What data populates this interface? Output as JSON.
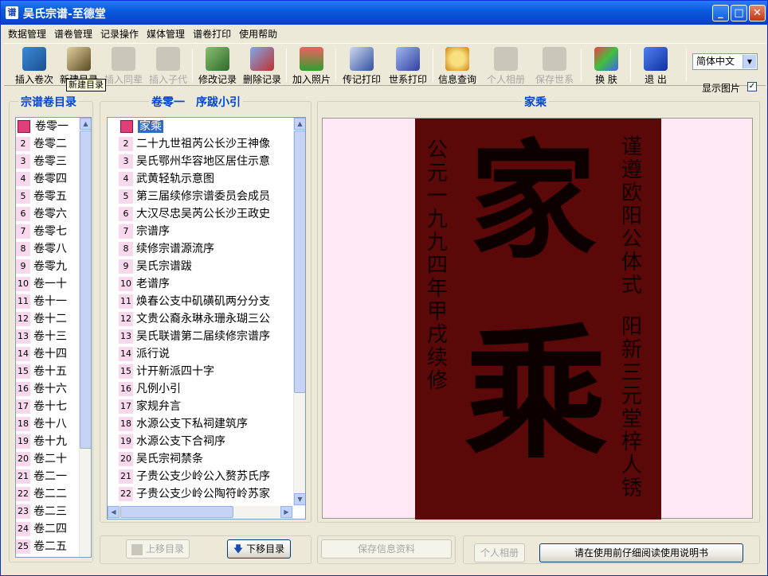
{
  "window": {
    "icon": "谱",
    "title": "吴氏宗谱-至德堂"
  },
  "menu": [
    "数据管理",
    "谱卷管理",
    "记录操作",
    "媒体管理",
    "谱卷打印",
    "使用帮助"
  ],
  "toolbar": {
    "insert_volume": "插入卷次",
    "new_catalog": "新建目录",
    "insert_peer": "插入同辈",
    "insert_child": "插入子代",
    "edit_record": "修改记录",
    "delete_record": "删除记录",
    "add_photo": "加入照片",
    "print_bio": "传记打印",
    "print_lineage": "世系打印",
    "info_query": "信息查询",
    "personal_album": "个人相册",
    "save_lineage": "保存世系",
    "change_skin": "换  肤",
    "exit": "退  出"
  },
  "tooltip": "新建目录",
  "language": {
    "selected": "简体中文"
  },
  "show_picture": {
    "label": "显示图片",
    "checked": "✓"
  },
  "left_panel": {
    "title": "宗谱卷目录",
    "items": [
      {
        "num": "",
        "label": "卷零一"
      },
      {
        "num": "2",
        "label": "卷零二"
      },
      {
        "num": "3",
        "label": "卷零三"
      },
      {
        "num": "4",
        "label": "卷零四"
      },
      {
        "num": "5",
        "label": "卷零五"
      },
      {
        "num": "6",
        "label": "卷零六"
      },
      {
        "num": "7",
        "label": "卷零七"
      },
      {
        "num": "8",
        "label": "卷零八"
      },
      {
        "num": "9",
        "label": "卷零九"
      },
      {
        "num": "10",
        "label": "卷一十"
      },
      {
        "num": "11",
        "label": "卷十一"
      },
      {
        "num": "12",
        "label": "卷十二"
      },
      {
        "num": "13",
        "label": "卷十三"
      },
      {
        "num": "14",
        "label": "卷十四"
      },
      {
        "num": "15",
        "label": "卷十五"
      },
      {
        "num": "16",
        "label": "卷十六"
      },
      {
        "num": "17",
        "label": "卷十七"
      },
      {
        "num": "18",
        "label": "卷十八"
      },
      {
        "num": "19",
        "label": "卷十九"
      },
      {
        "num": "20",
        "label": "卷二十"
      },
      {
        "num": "21",
        "label": "卷二一"
      },
      {
        "num": "22",
        "label": "卷二二"
      },
      {
        "num": "23",
        "label": "卷二三"
      },
      {
        "num": "24",
        "label": "卷二四"
      },
      {
        "num": "25",
        "label": "卷二五"
      }
    ],
    "move_up": "上移目录",
    "move_down": "下移目录"
  },
  "middle_panel": {
    "title": "卷零一　序跋小引",
    "items": [
      {
        "num": "",
        "label": "家乘"
      },
      {
        "num": "2",
        "label": "二十九世祖芮公长沙王神像"
      },
      {
        "num": "3",
        "label": "吴氏鄂州华容地区居住示意"
      },
      {
        "num": "4",
        "label": "武黄轻轨示意图"
      },
      {
        "num": "5",
        "label": "第三届续修宗谱委员会成员"
      },
      {
        "num": "6",
        "label": "大汉尽忠吴芮公长沙王政史"
      },
      {
        "num": "7",
        "label": "宗谱序"
      },
      {
        "num": "8",
        "label": "续修宗谱源流序"
      },
      {
        "num": "9",
        "label": "吴氏宗谱跋"
      },
      {
        "num": "10",
        "label": "老谱序"
      },
      {
        "num": "11",
        "label": "焕春公支中矶磺矶两分分支"
      },
      {
        "num": "12",
        "label": "文贵公裔永琳永珊永瑚三公"
      },
      {
        "num": "13",
        "label": "吴氏联谱第二届续修宗谱序"
      },
      {
        "num": "14",
        "label": "派行说"
      },
      {
        "num": "15",
        "label": "计开新派四十字"
      },
      {
        "num": "16",
        "label": "凡例小引"
      },
      {
        "num": "17",
        "label": "家规弁言"
      },
      {
        "num": "18",
        "label": "水源公支下私祠建筑序"
      },
      {
        "num": "19",
        "label": "水源公支下合祠序"
      },
      {
        "num": "20",
        "label": "吴氏宗祠禁条"
      },
      {
        "num": "21",
        "label": "子贵公支少岭公入赘苏氏序"
      },
      {
        "num": "22",
        "label": "子贵公支少岭公陶符岭苏家"
      }
    ],
    "save_info": "保存信息资料"
  },
  "right_panel": {
    "title": "家乘",
    "image": {
      "big_chars": [
        "家",
        "乘"
      ],
      "left_column": "公元一九九四年甲戌续修",
      "right_column_1": "谨遵欧阳公体式",
      "right_column_2": "阳新三元堂梓人锈"
    },
    "album_button": "个人相册",
    "manual_button": "请在使用前仔细阅读使用说明书"
  },
  "colors": {
    "title_bar": "#0A5BE0",
    "panel_title": "#0046D5",
    "scroll_image_bg": "#5B0808",
    "preview_bg": "#FDE8F3",
    "selection": "#316AC5"
  }
}
